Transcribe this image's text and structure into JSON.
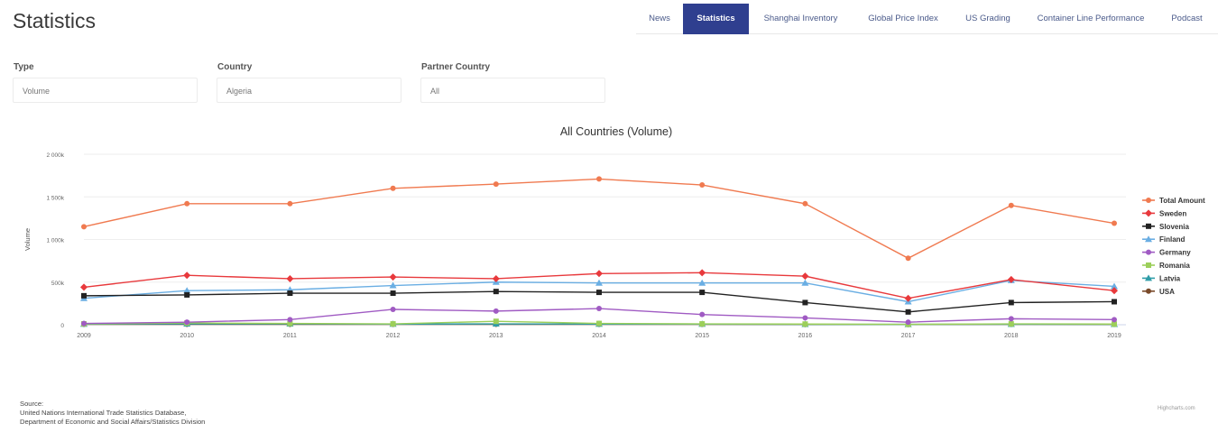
{
  "header": {
    "title": "Statistics"
  },
  "nav": {
    "tabs": [
      {
        "label": "News",
        "active": false
      },
      {
        "label": "Statistics",
        "active": true
      },
      {
        "label": "Shanghai Inventory",
        "active": false
      },
      {
        "label": "Global Price Index",
        "active": false
      },
      {
        "label": "US Grading",
        "active": false
      },
      {
        "label": "Container Line Performance",
        "active": false
      },
      {
        "label": "Podcast",
        "active": false
      }
    ]
  },
  "filters": {
    "type": {
      "label": "Type",
      "value": "Volume"
    },
    "country": {
      "label": "Country",
      "value": "Algeria"
    },
    "partner": {
      "label": "Partner Country",
      "value": "All"
    }
  },
  "chart_data": {
    "type": "line",
    "title": "All Countries (Volume)",
    "ylabel": "Volume",
    "xlabel": "",
    "x": [
      2009,
      2010,
      2011,
      2012,
      2013,
      2014,
      2015,
      2016,
      2017,
      2018,
      2019
    ],
    "ylim": [
      0,
      2000000
    ],
    "yticks": [
      0,
      500000,
      1000000,
      1500000,
      2000000
    ],
    "ytick_labels": [
      "0",
      "500k",
      "1 000k",
      "1 500k",
      "2 000k"
    ],
    "grid": true,
    "legend_position": "right",
    "series": [
      {
        "name": "Total Amount",
        "color": "#f07a50",
        "marker": "circle",
        "values": [
          1150000,
          1420000,
          1420000,
          1600000,
          1650000,
          1710000,
          1640000,
          1420000,
          780000,
          1400000,
          1190000
        ]
      },
      {
        "name": "Sweden",
        "color": "#e8393c",
        "marker": "diamond",
        "values": [
          440000,
          580000,
          540000,
          560000,
          540000,
          600000,
          610000,
          570000,
          310000,
          530000,
          400000
        ]
      },
      {
        "name": "Slovenia",
        "color": "#222222",
        "marker": "square",
        "values": [
          340000,
          350000,
          370000,
          370000,
          390000,
          380000,
          380000,
          260000,
          150000,
          260000,
          270000
        ]
      },
      {
        "name": "Finland",
        "color": "#6aaee3",
        "marker": "triangle",
        "values": [
          310000,
          400000,
          410000,
          460000,
          500000,
          490000,
          490000,
          490000,
          270000,
          520000,
          450000
        ]
      },
      {
        "name": "Germany",
        "color": "#a05bc3",
        "marker": "circle",
        "values": [
          15000,
          30000,
          60000,
          180000,
          160000,
          190000,
          120000,
          80000,
          30000,
          70000,
          60000
        ]
      },
      {
        "name": "Romania",
        "color": "#9ccf5a",
        "marker": "square",
        "values": [
          10000,
          20000,
          15000,
          10000,
          40000,
          15000,
          10000,
          8000,
          5000,
          10000,
          8000
        ]
      },
      {
        "name": "Latvia",
        "color": "#2f9da8",
        "marker": "triangle",
        "values": [
          8000,
          10000,
          10000,
          8000,
          10000,
          8000,
          8000,
          5000,
          4000,
          6000,
          5000
        ]
      },
      {
        "name": "USA",
        "color": "#7a4a2a",
        "marker": "circle",
        "values": [
          5000,
          5000,
          5000,
          5000,
          5000,
          5000,
          5000,
          3000,
          3000,
          5000,
          4000
        ]
      }
    ]
  },
  "footer": {
    "source_label": "Source:",
    "source_line1": "United Nations International Trade Statistics Database,",
    "source_line2": "Department of Economic and Social Affairs/Statistics Division",
    "credits": "Highcharts.com"
  }
}
